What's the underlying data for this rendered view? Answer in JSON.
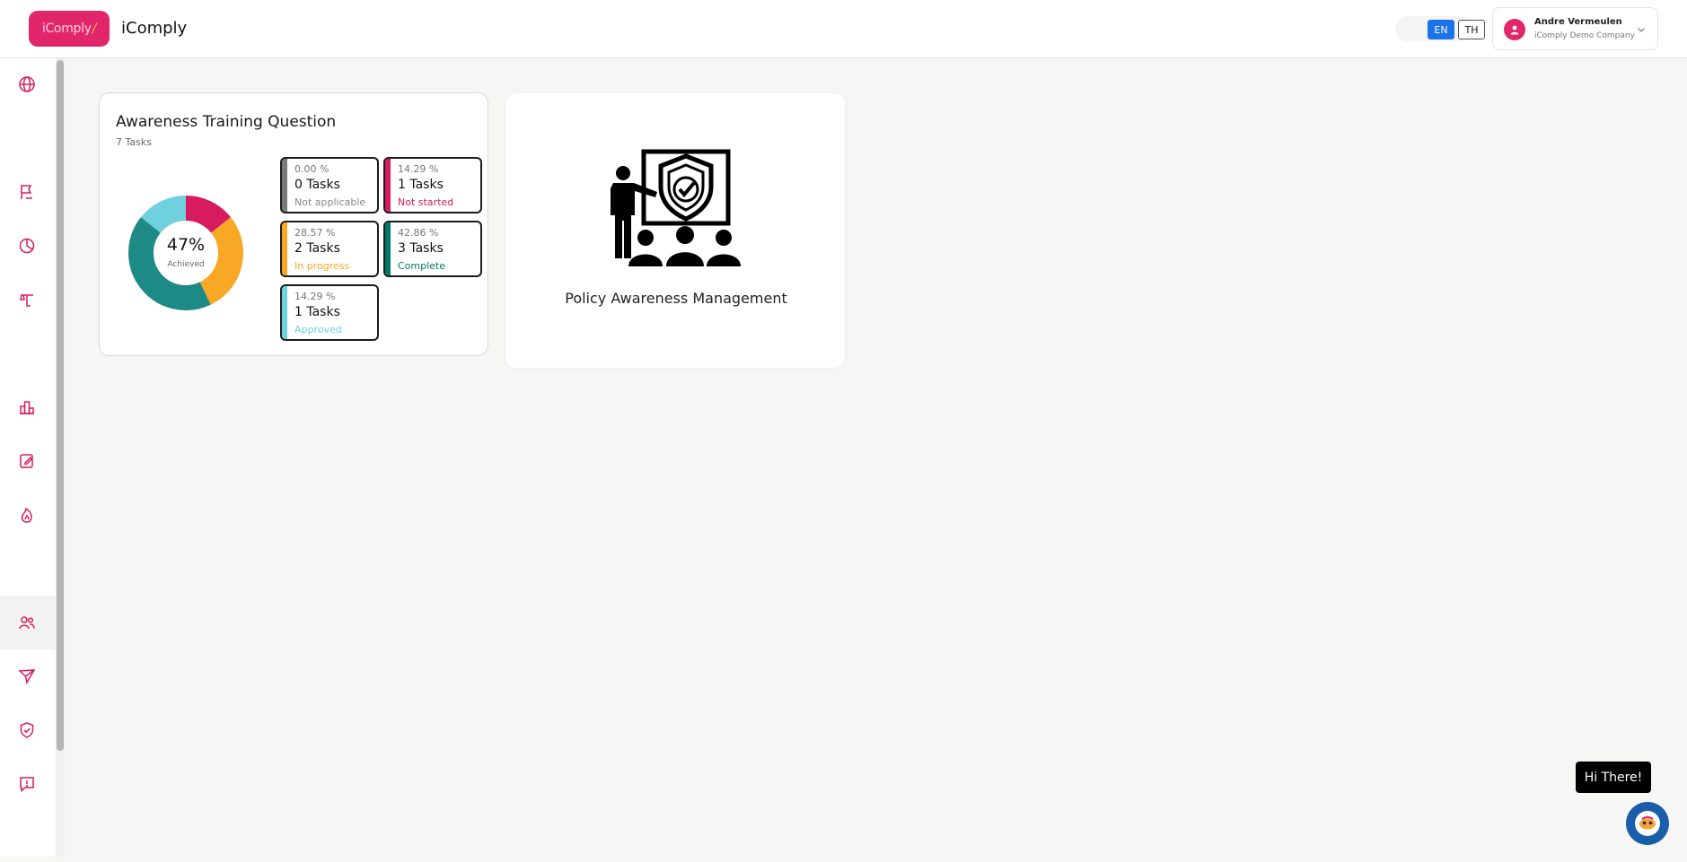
{
  "header": {
    "logo_text": "iComply",
    "logo_mark": "/",
    "app_title": "iComply",
    "languages": [
      "EN",
      "TH"
    ],
    "active_language": "EN",
    "user": {
      "name": "Andre Vermeulen",
      "company": "iComply Demo Company"
    }
  },
  "sidebar": {
    "items": [
      {
        "icon": "globe-icon"
      },
      {
        "icon": "flag-icon"
      },
      {
        "icon": "pie-chart-icon"
      },
      {
        "icon": "scale-icon"
      },
      {
        "icon": "podium-icon"
      },
      {
        "icon": "edit-note-icon"
      },
      {
        "icon": "flame-icon"
      },
      {
        "icon": "users-icon",
        "active": true
      },
      {
        "icon": "send-icon"
      },
      {
        "icon": "shield-check-icon"
      },
      {
        "icon": "feedback-icon"
      }
    ]
  },
  "awareness_card": {
    "title": "Awareness Training Question",
    "subtitle": "7 Tasks",
    "donut": {
      "percent_text": "47%",
      "label": "Achieved"
    },
    "stats": [
      {
        "pct": "0.00 %",
        "count": "0 Tasks",
        "label": "Not applicable",
        "color": "#7a7a7a"
      },
      {
        "pct": "14.29 %",
        "count": "1 Tasks",
        "label": "Not started",
        "color": "#d81b60"
      },
      {
        "pct": "28.57 %",
        "count": "2 Tasks",
        "label": "In progress",
        "color": "#f9a825"
      },
      {
        "pct": "42.86 %",
        "count": "3 Tasks",
        "label": "Complete",
        "color": "#00796b"
      },
      {
        "pct": "14.29 %",
        "count": "1 Tasks",
        "label": "Approved",
        "color": "#6fd0de"
      }
    ]
  },
  "chart_data": {
    "type": "pie",
    "categories": [
      "Not applicable",
      "Not started",
      "In progress",
      "Complete",
      "Approved"
    ],
    "values": [
      0.0,
      14.29,
      28.57,
      42.86,
      14.29
    ],
    "colors": [
      "#7a7a7a",
      "#d81b60",
      "#f9a825",
      "#1e8a85",
      "#6fd0de"
    ],
    "center_text": "47%"
  },
  "policy_card": {
    "title": "Policy Awareness Management"
  },
  "chat": {
    "greeting": "Hi There!"
  },
  "colors": {
    "brand": "#e2266b",
    "accent_blue": "#1a73e8"
  }
}
